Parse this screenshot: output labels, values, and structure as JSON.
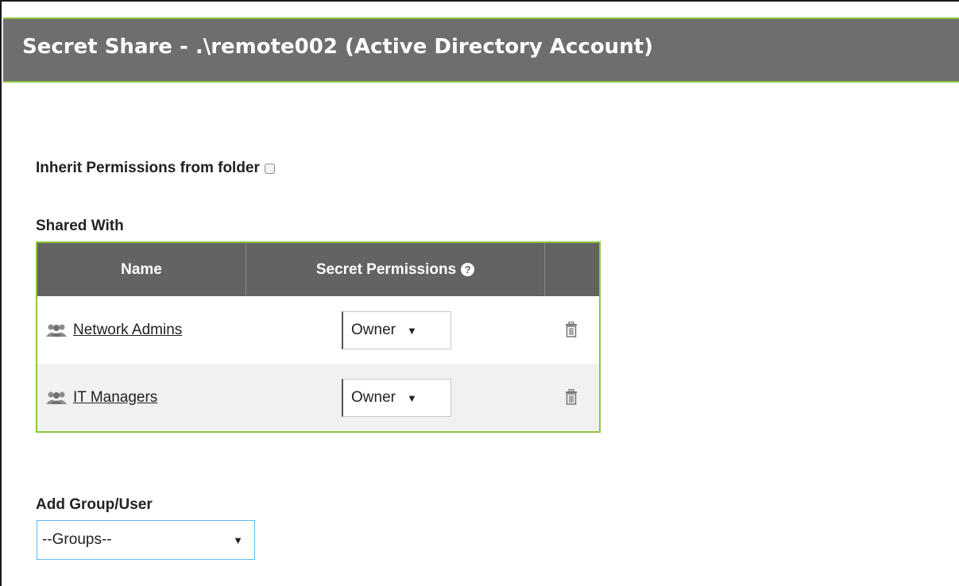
{
  "header": {
    "title": "Secret Share - .\\remote002 (Active Directory Account)"
  },
  "inherit": {
    "label": "Inherit Permissions from folder",
    "checked": false
  },
  "shared_with": {
    "label": "Shared With",
    "columns": [
      "Name",
      "Secret Permissions",
      ""
    ],
    "rows": [
      {
        "name": "Network Admins",
        "permission": "Owner",
        "icon": "group-icon"
      },
      {
        "name": "IT Managers",
        "permission": "Owner",
        "icon": "group-icon"
      }
    ]
  },
  "add": {
    "label": "Add Group/User",
    "selected": "--Groups--"
  },
  "colors": {
    "header_bg": "#6e6e6e",
    "accent": "#8cc63f",
    "table_header_bg": "#636363",
    "select_focus": "#5fb9ec"
  }
}
